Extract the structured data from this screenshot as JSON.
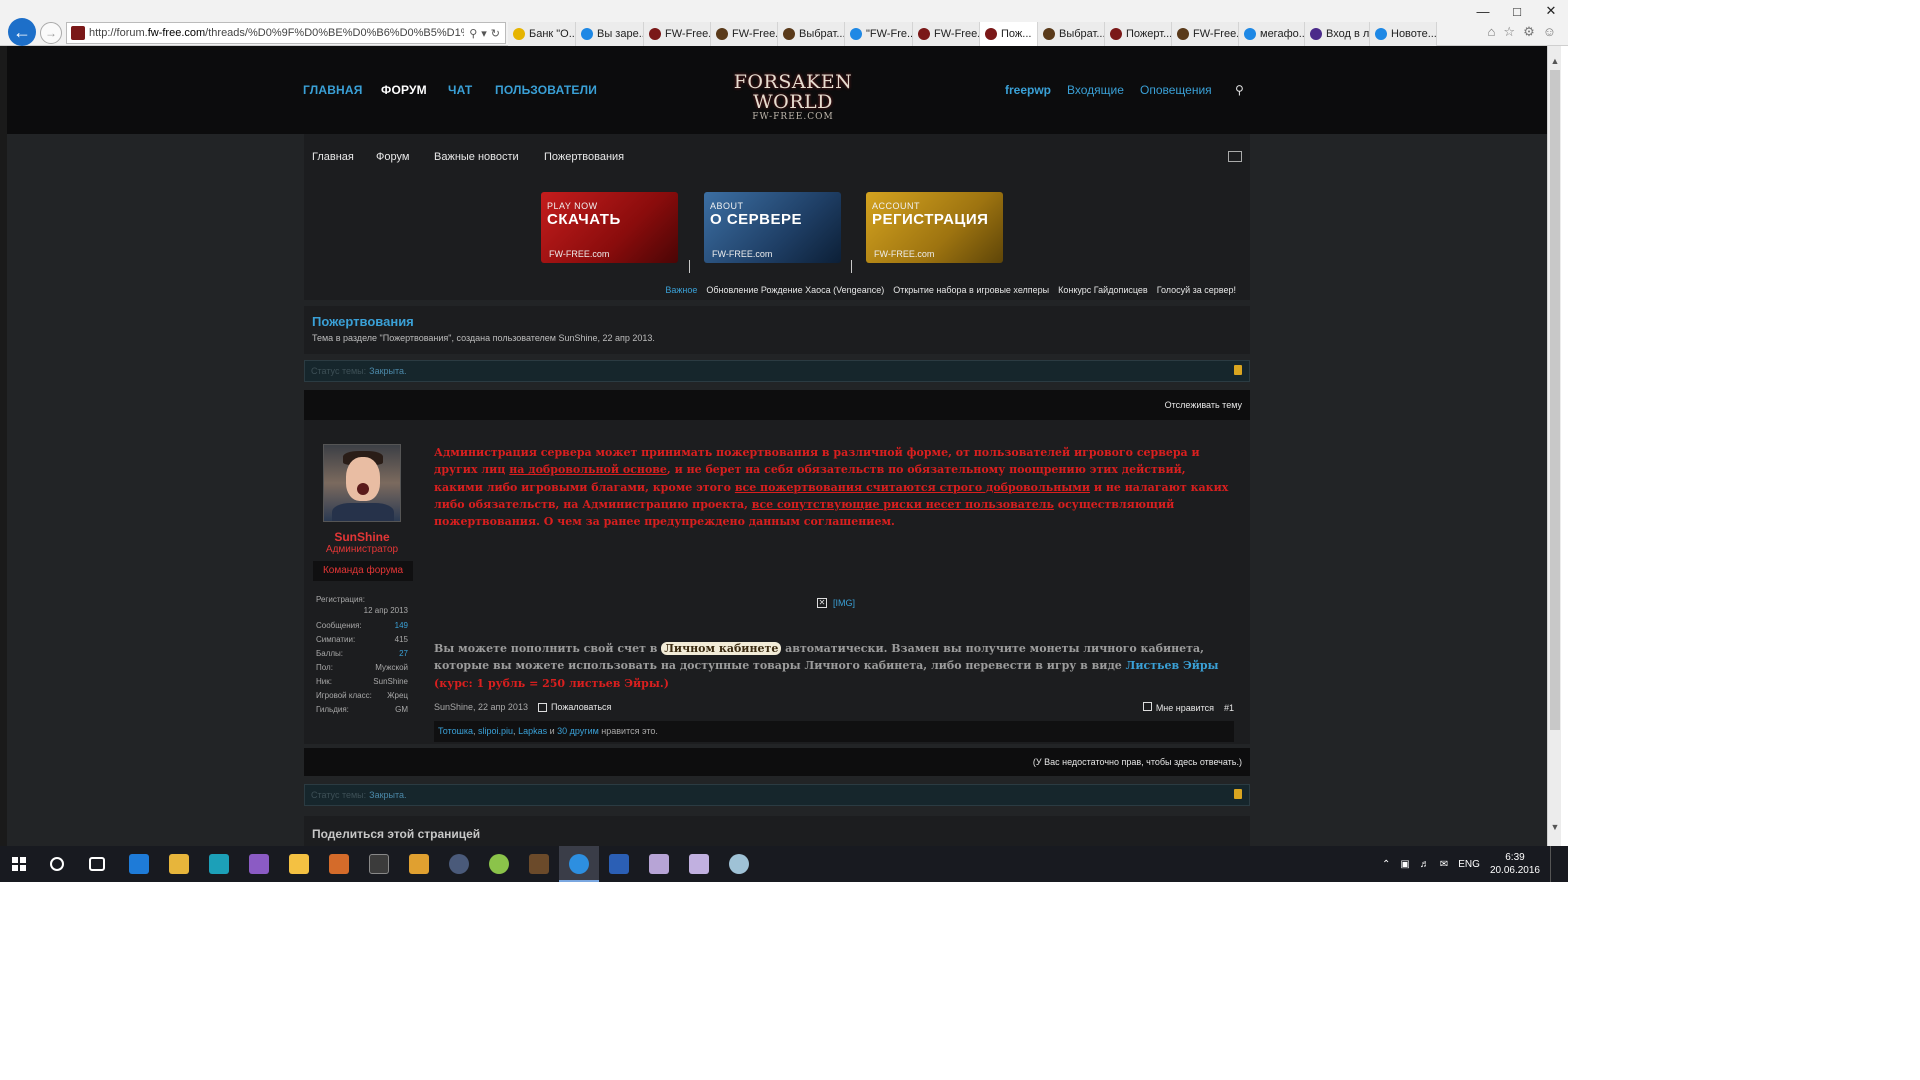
{
  "browser": {
    "url_prefix": "http://forum.",
    "url_domain": "fw-free.com",
    "url_rest": "/threads/%D0%9F%D0%BE%D0%B6%D0%B5%D1%80%D1%8...",
    "tabs": [
      {
        "label": "Банк \"О...",
        "color": "#e6b400"
      },
      {
        "label": "Вы заре...",
        "color": "#1e88e5"
      },
      {
        "label": "FW-Free...",
        "color": "#7a1818"
      },
      {
        "label": "FW-Free...",
        "color": "#5a3a1a"
      },
      {
        "label": "Выбрат...",
        "color": "#5a3a1a"
      },
      {
        "label": "\"FW-Fre...",
        "color": "#1e88e5"
      },
      {
        "label": "FW-Free...",
        "color": "#7a1818"
      },
      {
        "label": "Пож...",
        "color": "#7a1818",
        "active": true
      },
      {
        "label": "Выбрат...",
        "color": "#5a3a1a"
      },
      {
        "label": "Пожерт...",
        "color": "#7a1818"
      },
      {
        "label": "FW-Free...",
        "color": "#5a3a1a"
      },
      {
        "label": "мегафо...",
        "color": "#1e88e5"
      },
      {
        "label": "Вход в л...",
        "color": "#4b2a8a"
      },
      {
        "label": "Новоте...",
        "color": "#1e88e5"
      }
    ]
  },
  "header": {
    "nav": [
      "ГЛАВНАЯ",
      "ФОРУМ",
      "ЧАТ",
      "ПОЛЬЗОВАТЕЛИ"
    ],
    "logo_line1": "FORSAKEN",
    "logo_line2": "WORLD",
    "logo_line3": "FW-FREE.COM",
    "username": "freepwp",
    "inbox": "Входящие",
    "alerts": "Оповещения"
  },
  "subnav": [
    "Главная",
    "Форум",
    "Важные новости",
    "Пожертвования"
  ],
  "banners": [
    {
      "small": "PLAY NOW",
      "big": "СКАЧАТЬ",
      "foot": "FW-FREE.com"
    },
    {
      "small": "ABOUT",
      "big": "О СЕРВЕРЕ",
      "foot": "FW-FREE.com"
    },
    {
      "small": "ACCOUNT",
      "big": "РЕГИСТРАЦИЯ",
      "foot": "FW-FREE.com"
    }
  ],
  "news": {
    "label": "Важное",
    "items": [
      "Обновление Рождение Хаоса (Vengeance)",
      "Открытие набора в игровые хелперы",
      "Конкурс Гайдописцев",
      "Голосуй за сервер!"
    ]
  },
  "thread": {
    "title": "Пожертвования",
    "subtitle": "Тема в разделе \"Пожертвования\", создана пользователем SunShine, 22 апр 2013.",
    "status_label": "Статус темы:",
    "status_value": "Закрыта.",
    "watch": "Отслеживать тему"
  },
  "post": {
    "user": {
      "name": "SunShine",
      "role": "Администратор",
      "team": "Команда форума",
      "stats": [
        {
          "k": "Сообщения:",
          "v": "149",
          "link": true
        },
        {
          "k": "Симпатии:",
          "v": "415",
          "link": false
        },
        {
          "k": "Баллы:",
          "v": "27",
          "link": true
        },
        {
          "k": "Пол:",
          "v": "Мужской",
          "link": false
        },
        {
          "k": "Ник:",
          "v": "SunShine",
          "link": false
        },
        {
          "k": "Игровой класс:",
          "v": "Жрец",
          "link": false
        },
        {
          "k": "Гильдия:",
          "v": "GM",
          "link": false
        }
      ],
      "reg_label": "Регистрация:",
      "reg_date": "12 апр 2013"
    },
    "warn_1": "Администрация сервера может принимать пожертвования в различной форме, от пользователей игрового сервера и других лиц ",
    "warn_u1": "на добровольной основе",
    "warn_2": ", и не берет на себя обязательств по обязательному поощрению этих действий, какими либо игровыми благами, кроме этого ",
    "warn_u2": "все пожертвования считаются строго добровольными",
    "warn_3": " и не налагают каких либо обязательств, на Администрацию проекта, ",
    "warn_u3": "все сопутствующие риски несет пользователь",
    "warn_4": " осуществляющий пожертвования. О чем за ранее предупреждено данным соглашением.",
    "img_label": "[IMG]",
    "msg_1": "Вы можете пополнить свой счет в ",
    "msg_hl": "Личном кабинете",
    "msg_2": " автоматически. Взамен вы получите монеты личного кабинета, которые вы можете использовать на доступные товары Личного кабинета, либо перевести в игру в виде ",
    "msg_blue": "Листьев Эйры",
    "msg_red": " (курс: 1 рубль = 250 листьев Эйры.)",
    "meta_author": "SunShine, 22 апр 2013",
    "report": "Пожаловаться",
    "like": "Мне нравится",
    "num": "#1",
    "likes_u1": "Тотошка",
    "likes_u2": "slipoi.piu",
    "likes_u3": "Lapkas",
    "likes_and": " и ",
    "likes_more": "30 другим",
    "likes_end": " нравится это."
  },
  "reply_note": "(У Вас недостаточно прав, чтобы здесь отвечать.)",
  "share": "Поделиться этой страницей",
  "taskbar": {
    "lang": "ENG",
    "time": "6:39",
    "date": "20.06.2016"
  }
}
